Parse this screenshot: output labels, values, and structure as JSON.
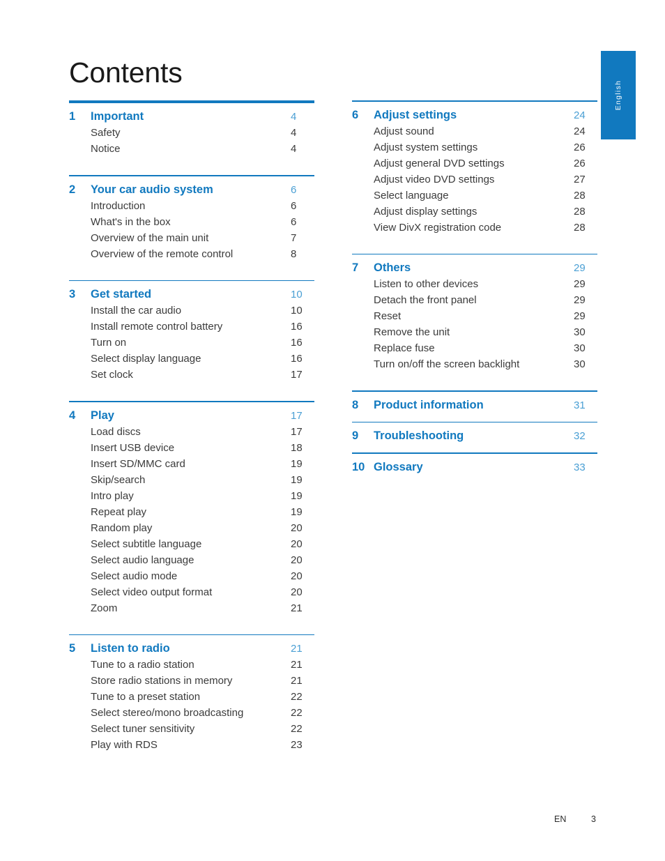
{
  "document": {
    "title": "Contents",
    "language_tab": "English",
    "footer": {
      "language_code": "EN",
      "page_number": "3"
    },
    "colors": {
      "accent_blue": "#1179bf",
      "page_number_blue": "#4a9fd4",
      "body_text": "#3b3b3b",
      "title_text": "#1a1a1a"
    }
  },
  "columns": {
    "left": [
      {
        "number": "1",
        "title": "Important",
        "page": "4",
        "rule": "thick",
        "items": [
          {
            "title": "Safety",
            "page": "4"
          },
          {
            "title": "Notice",
            "page": "4"
          }
        ]
      },
      {
        "number": "2",
        "title": "Your car audio system",
        "page": "6",
        "rule": "thin",
        "items": [
          {
            "title": "Introduction",
            "page": "6"
          },
          {
            "title": "What's in the box",
            "page": "6"
          },
          {
            "title": "Overview of the main unit",
            "page": "7"
          },
          {
            "title": "Overview of the remote control",
            "page": "8"
          }
        ]
      },
      {
        "number": "3",
        "title": "Get started",
        "page": "10",
        "rule": "thin",
        "items": [
          {
            "title": "Install the car audio",
            "page": "10"
          },
          {
            "title": "Install remote control battery",
            "page": "16"
          },
          {
            "title": "Turn on",
            "page": "16"
          },
          {
            "title": "Select display language",
            "page": "16"
          },
          {
            "title": "Set clock",
            "page": "17"
          }
        ]
      },
      {
        "number": "4",
        "title": "Play",
        "page": "17",
        "rule": "thin",
        "items": [
          {
            "title": "Load discs",
            "page": "17"
          },
          {
            "title": "Insert USB device",
            "page": "18"
          },
          {
            "title": "Insert SD/MMC card",
            "page": "19"
          },
          {
            "title": "Skip/search",
            "page": "19"
          },
          {
            "title": "Intro play",
            "page": "19"
          },
          {
            "title": "Repeat play",
            "page": "19"
          },
          {
            "title": "Random play",
            "page": "20"
          },
          {
            "title": "Select subtitle language",
            "page": "20"
          },
          {
            "title": "Select audio language",
            "page": "20"
          },
          {
            "title": "Select audio mode",
            "page": "20"
          },
          {
            "title": "Select video output format",
            "page": "20"
          },
          {
            "title": "Zoom",
            "page": "21"
          }
        ]
      },
      {
        "number": "5",
        "title": "Listen to radio",
        "page": "21",
        "rule": "thin",
        "items": [
          {
            "title": "Tune to a radio station",
            "page": "21"
          },
          {
            "title": "Store radio stations in memory",
            "page": "21"
          },
          {
            "title": "Tune to a preset station",
            "page": "22"
          },
          {
            "title": "Select stereo/mono broadcasting",
            "page": "22"
          },
          {
            "title": "Select tuner sensitivity",
            "page": "22"
          },
          {
            "title": "Play with RDS",
            "page": "23"
          }
        ]
      }
    ],
    "right": [
      {
        "number": "6",
        "title": "Adjust settings",
        "page": "24",
        "rule": "thin",
        "items": [
          {
            "title": "Adjust sound",
            "page": "24"
          },
          {
            "title": "Adjust system settings",
            "page": "26"
          },
          {
            "title": "Adjust general DVD settings",
            "page": "26"
          },
          {
            "title": "Adjust video DVD settings",
            "page": "27"
          },
          {
            "title": "Select language",
            "page": "28"
          },
          {
            "title": "Adjust display settings",
            "page": "28"
          },
          {
            "title": "View DivX registration code",
            "page": "28"
          }
        ]
      },
      {
        "number": "7",
        "title": "Others",
        "page": "29",
        "rule": "thin",
        "items": [
          {
            "title": "Listen to other devices",
            "page": "29"
          },
          {
            "title": "Detach the front panel",
            "page": "29"
          },
          {
            "title": "Reset",
            "page": "29"
          },
          {
            "title": "Remove the unit",
            "page": "30"
          },
          {
            "title": "Replace fuse",
            "page": "30"
          },
          {
            "title": "Turn on/off the screen backlight",
            "page": "30"
          }
        ]
      },
      {
        "number": "8",
        "title": "Product information",
        "page": "31",
        "rule": "thin",
        "items": []
      },
      {
        "number": "9",
        "title": "Troubleshooting",
        "page": "32",
        "rule": "thin",
        "items": []
      },
      {
        "number": "10",
        "title": "Glossary",
        "page": "33",
        "rule": "thin",
        "items": []
      }
    ]
  }
}
